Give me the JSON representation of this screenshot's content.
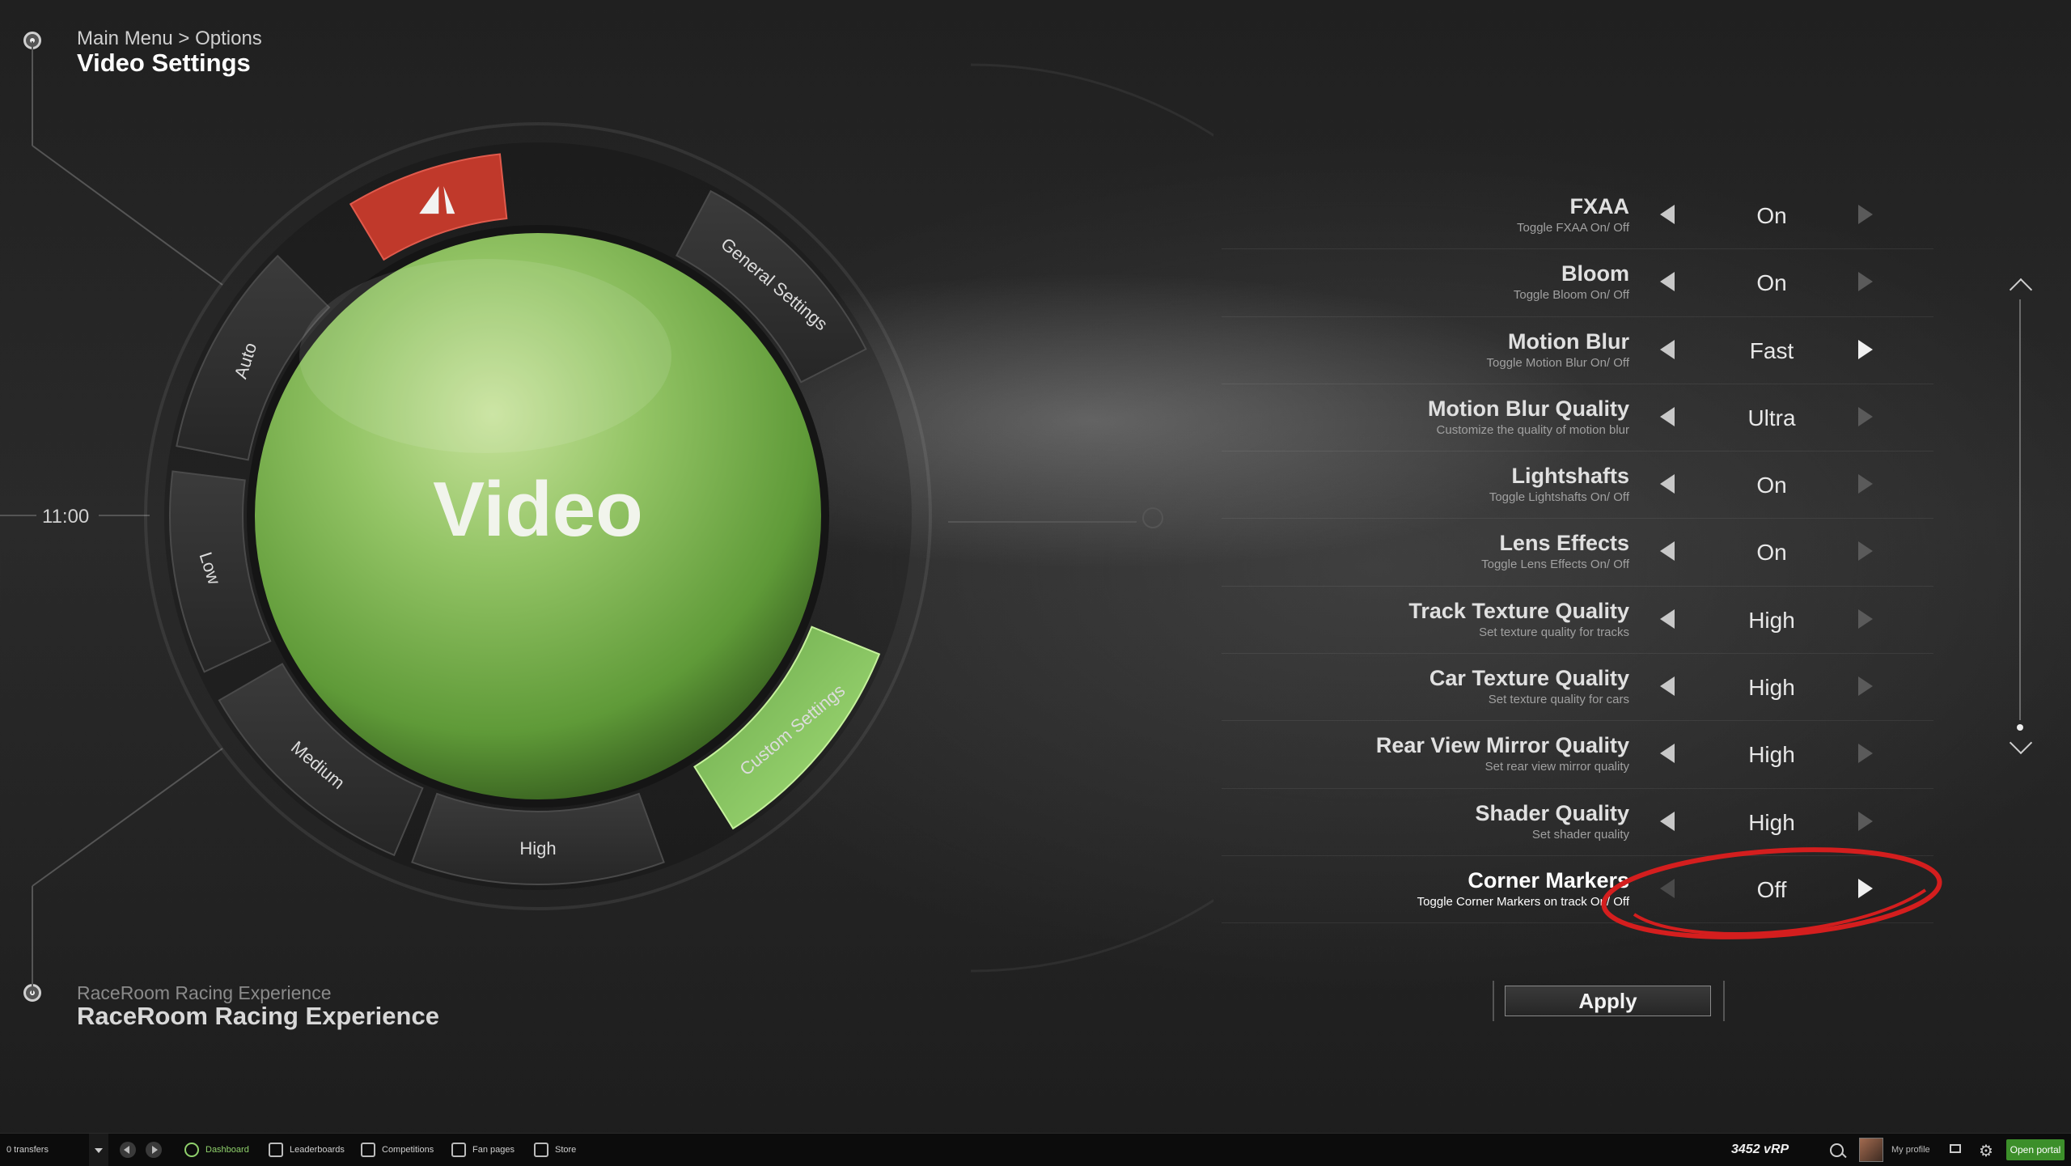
{
  "header": {
    "breadcrumb": "Main Menu > Options",
    "title": "Video Settings",
    "game_subtitle": "RaceRoom Racing Experience",
    "game_title": "RaceRoom Racing Experience",
    "clock": "11:00"
  },
  "dial": {
    "center_label": "Video",
    "segments": {
      "general": "General Settings",
      "auto": "Auto",
      "low": "Low",
      "medium": "Medium",
      "high": "High",
      "custom": "Custom Settings"
    },
    "selected_segment": "Custom Settings",
    "logo_icon": "raceroom-logo-icon"
  },
  "settings": [
    {
      "name": "FXAA",
      "desc": "Toggle FXAA On/ Off",
      "value": "On",
      "right_active": false
    },
    {
      "name": "Bloom",
      "desc": "Toggle Bloom On/ Off",
      "value": "On",
      "right_active": false
    },
    {
      "name": "Motion Blur",
      "desc": "Toggle Motion Blur On/ Off",
      "value": "Fast",
      "right_active": true
    },
    {
      "name": "Motion Blur Quality",
      "desc": "Customize the quality of motion blur",
      "value": "Ultra",
      "right_active": false
    },
    {
      "name": "Lightshafts",
      "desc": "Toggle Lightshafts On/ Off",
      "value": "On",
      "right_active": false
    },
    {
      "name": "Lens Effects",
      "desc": "Toggle Lens Effects On/ Off",
      "value": "On",
      "right_active": false
    },
    {
      "name": "Track Texture Quality",
      "desc": "Set texture quality for tracks",
      "value": "High",
      "right_active": false
    },
    {
      "name": "Car Texture Quality",
      "desc": "Set texture quality for cars",
      "value": "High",
      "right_active": false
    },
    {
      "name": "Rear View Mirror Quality",
      "desc": "Set rear view mirror quality",
      "value": "High",
      "right_active": false
    },
    {
      "name": "Shader Quality",
      "desc": "Set shader quality",
      "value": "High",
      "right_active": false
    },
    {
      "name": "Corner Markers",
      "desc": "Toggle Corner Markers on track On/ Off",
      "value": "Off",
      "right_active": true
    }
  ],
  "apply_label": "Apply",
  "annotation_color": "#d41e1e",
  "accent_green": "#7fbf4f",
  "taskbar": {
    "transfers": "0 transfers",
    "dashboard": "Dashboard",
    "leaderboards": "Leaderboards",
    "competitions": "Competitions",
    "fan_pages": "Fan pages",
    "store": "Store",
    "vrp": "3452 vRP",
    "my_profile": "My profile",
    "open_portal": "Open portal"
  }
}
